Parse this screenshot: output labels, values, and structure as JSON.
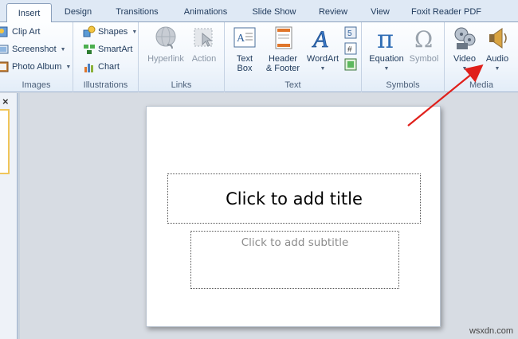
{
  "tabs": [
    {
      "label": "Insert",
      "active": true
    },
    {
      "label": "Design"
    },
    {
      "label": "Transitions"
    },
    {
      "label": "Animations"
    },
    {
      "label": "Slide Show"
    },
    {
      "label": "Review"
    },
    {
      "label": "View"
    },
    {
      "label": "Foxit Reader PDF"
    }
  ],
  "groups": {
    "images": {
      "label": "Images",
      "clip_art": "Clip Art",
      "screenshot": "Screenshot",
      "photo_album": "Photo Album"
    },
    "illustrations": {
      "label": "Illustrations",
      "shapes": "Shapes",
      "smartart": "SmartArt",
      "chart": "Chart"
    },
    "links": {
      "label": "Links",
      "hyperlink": "Hyperlink",
      "action": "Action"
    },
    "text": {
      "label": "Text",
      "text_box_1": "Text",
      "text_box_2": "Box",
      "header_footer_1": "Header",
      "header_footer_2": "& Footer",
      "wordart": "WordArt"
    },
    "symbols": {
      "label": "Symbols",
      "equation": "Equation",
      "symbol": "Symbol"
    },
    "media": {
      "label": "Media",
      "video": "Video",
      "audio": "Audio"
    }
  },
  "slide": {
    "title_placeholder": "Click to add title",
    "subtitle_placeholder": "Click to add subtitle"
  },
  "close_glyph": "×",
  "watermark": "wsxdn.com",
  "colors": {
    "annotation_arrow": "#e0201b",
    "thumbnail_highlight": "#f0c55a"
  }
}
